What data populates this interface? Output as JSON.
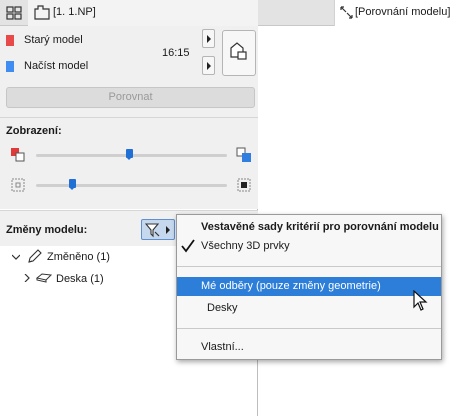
{
  "tabbar": {
    "active_tab_label": "[1. 1.NP]",
    "right_tab_label": "[Porovnání modelu]"
  },
  "models": {
    "old_label": "Starý model",
    "old_color": "#e84a4a",
    "load_label": "Načíst model",
    "load_color": "#3f8cf2",
    "time": "16:15"
  },
  "compare_button": "Porovnat",
  "view": {
    "title": "Zobrazení:",
    "slider1_value": 0.49,
    "slider2_value": 0.19
  },
  "changes": {
    "title": "Změny modelu:",
    "tree": [
      {
        "label": "Změněno (1)"
      },
      {
        "label": "Deska (1)"
      }
    ]
  },
  "menu": {
    "header": "Vestavěné sady kritérií pro porovnání modelu",
    "items": {
      "all3d": "Všechny 3D prvky",
      "my_subscriptions": "Mé odběry (pouze změny geometrie)",
      "slabs": "Desky",
      "custom": "Vlastní..."
    },
    "highlight_color": "#2d7ed8"
  }
}
